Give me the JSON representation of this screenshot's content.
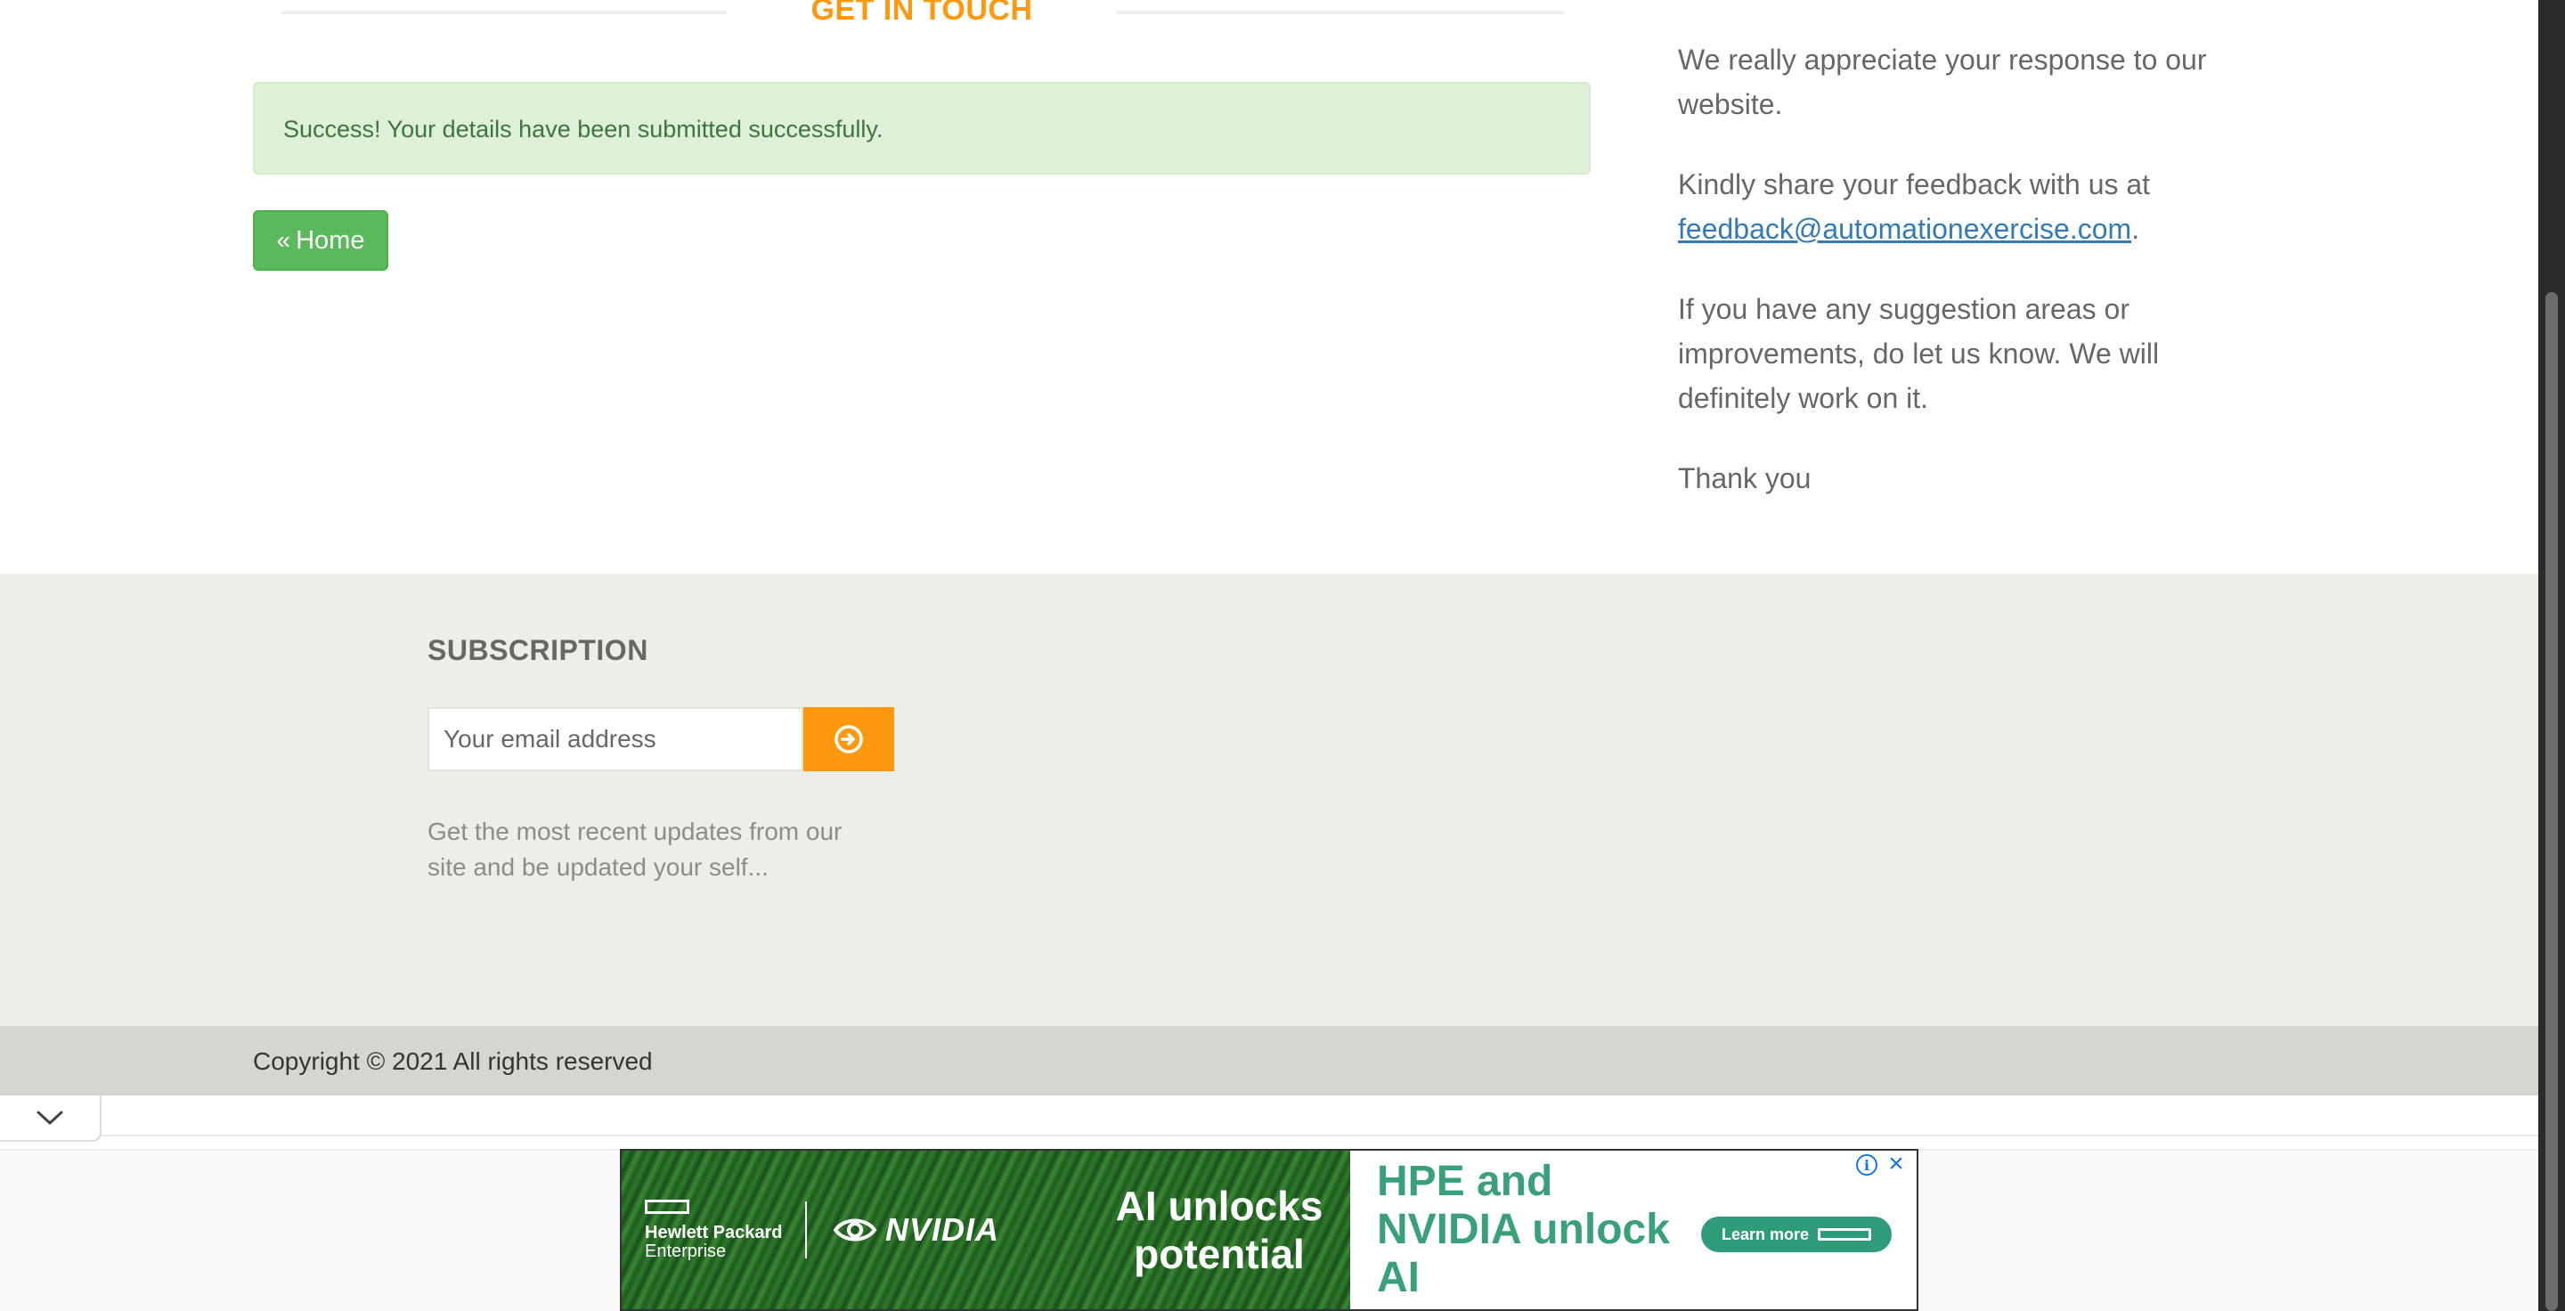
{
  "contact": {
    "section_title": "GET IN TOUCH",
    "success_message": "Success! Your details have been submitted successfully.",
    "home_button": "Home"
  },
  "feedback": {
    "para1": "We really appreciate your response to our website.",
    "para2_prefix": "Kindly share your feedback with us at ",
    "email": "feedback@automationexercise.com",
    "para2_suffix": ".",
    "para3": "If you have any suggestion areas or improvements, do let us know. We will definitely work on it.",
    "para4": "Thank you"
  },
  "footer": {
    "subscription_title": "SUBSCRIPTION",
    "email_placeholder": "Your email address",
    "description": "Get the most recent updates from our site and be updated your self...",
    "copyright": "Copyright © 2021 All rights reserved"
  },
  "ad": {
    "brand_line1": "Hewlett Packard",
    "brand_line2": "Enterprise",
    "partner": "NVIDIA",
    "headline": "AI unlocks potential",
    "tagline": "HPE and NVIDIA unlock AI",
    "cta": "Learn more",
    "info_icon": "info-icon",
    "close_icon": "close-icon",
    "accent_color": "#2e9b7a"
  },
  "colors": {
    "accent": "#fe980f",
    "success_bg": "#dff0d8",
    "success_text": "#3c763d",
    "home_button": "#5cb85c",
    "footer_bg": "#eeeee9",
    "footer_bottom_bg": "#d6d6d0",
    "link": "#337ab7"
  }
}
